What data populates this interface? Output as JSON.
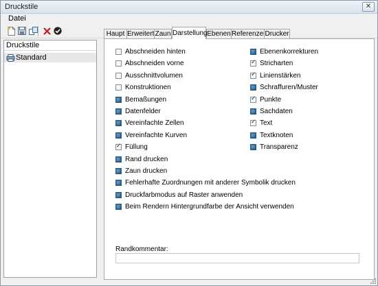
{
  "window": {
    "title": "Druckstile",
    "close_label": "✕"
  },
  "menu": {
    "items": [
      "Datei"
    ]
  },
  "toolbar": {
    "icons": [
      "new-icon",
      "save-icon",
      "copy-icon",
      "delete-icon",
      "apply-icon"
    ]
  },
  "left_panel": {
    "header": "Druckstile",
    "items": [
      {
        "label": "Standard",
        "icon": "print-style-icon",
        "selected": true
      }
    ]
  },
  "tabs": [
    {
      "label": "Haupt",
      "active": false
    },
    {
      "label": "Erweitert",
      "active": false
    },
    {
      "label": "Zaun",
      "active": false
    },
    {
      "label": "Darstellung",
      "active": true
    },
    {
      "label": "Ebenen",
      "active": false
    },
    {
      "label": "Referenzen",
      "active": false
    },
    {
      "label": "Drucker",
      "active": false
    }
  ],
  "display_options": {
    "left_column": [
      {
        "label": "Abschneiden hinten",
        "state": "unchecked"
      },
      {
        "label": "Abschneiden vorne",
        "state": "unchecked"
      },
      {
        "label": "Ausschnittvolumen",
        "state": "unchecked"
      },
      {
        "label": "Konstruktionen",
        "state": "unchecked"
      },
      {
        "label": "Bemaßungen",
        "state": "indeterminate"
      },
      {
        "label": "Datenfelder",
        "state": "indeterminate"
      },
      {
        "label": "Vereinfachte Zellen",
        "state": "indeterminate"
      },
      {
        "label": "Vereinfachte Kurven",
        "state": "indeterminate"
      },
      {
        "label": "Füllung",
        "state": "checked"
      },
      {
        "label": "Rand drucken",
        "state": "indeterminate"
      },
      {
        "label": "Zaun drucken",
        "state": "indeterminate"
      },
      {
        "label": "Fehlerhafte Zuordnungen mit anderer Symbolik drucken",
        "state": "indeterminate"
      },
      {
        "label": "Druckfarbmodus auf Raster anwenden",
        "state": "indeterminate"
      },
      {
        "label": "Beim Rendern Hintergrundfarbe der Ansicht verwenden",
        "state": "indeterminate"
      }
    ],
    "right_column": [
      {
        "label": "Ebenenkorrekturen",
        "state": "indeterminate"
      },
      {
        "label": "Stricharten",
        "state": "checked"
      },
      {
        "label": "Linienstärken",
        "state": "checked"
      },
      {
        "label": "Schraffuren/Muster",
        "state": "indeterminate"
      },
      {
        "label": "Punkte",
        "state": "checked"
      },
      {
        "label": "Sachdaten",
        "state": "indeterminate"
      },
      {
        "label": "Text",
        "state": "checked"
      },
      {
        "label": "Textknoten",
        "state": "indeterminate"
      },
      {
        "label": "Transparenz",
        "state": "indeterminate"
      }
    ]
  },
  "comment": {
    "label": "Randkommentar:",
    "value": ""
  }
}
